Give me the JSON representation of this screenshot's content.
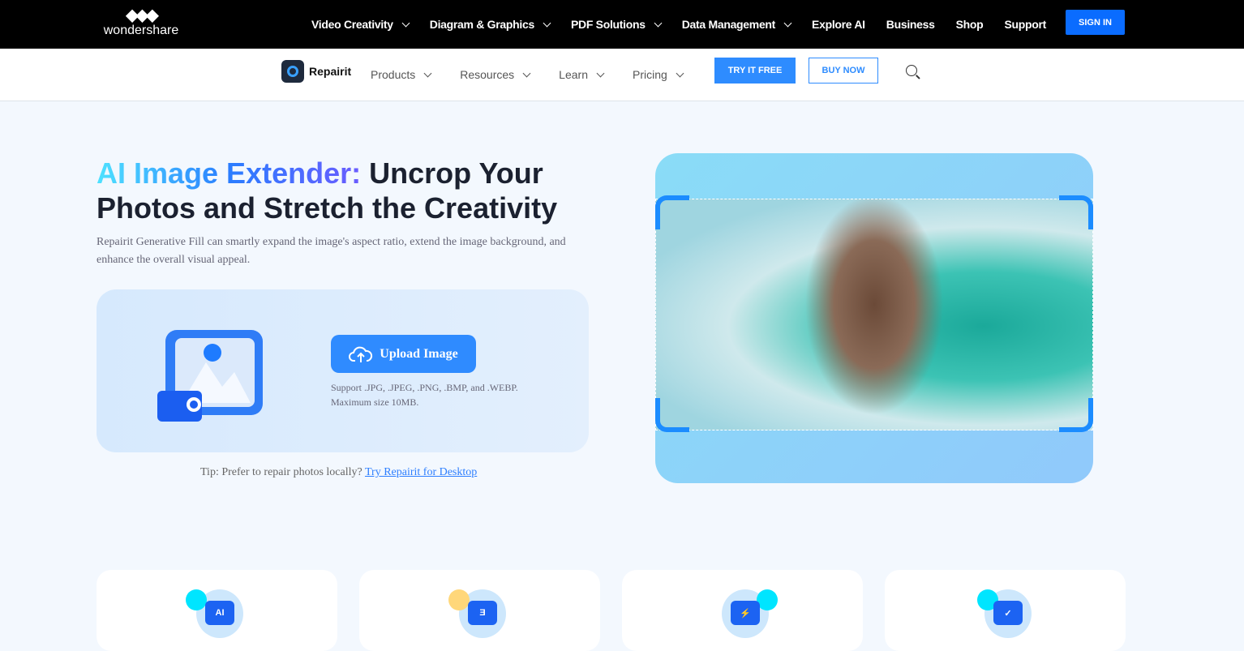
{
  "topbar": {
    "brand": "wondershare",
    "nav": [
      "Video Creativity",
      "Diagram & Graphics",
      "PDF Solutions",
      "Data Management",
      "Explore AI",
      "Business",
      "Shop",
      "Support"
    ],
    "nav_has_dropdown": [
      true,
      true,
      true,
      true,
      false,
      false,
      false,
      false
    ],
    "sign_in": "SIGN IN"
  },
  "subbar": {
    "brand": "Repairit",
    "nav": [
      "Products",
      "Resources",
      "Learn",
      "Pricing"
    ],
    "try_free": "TRY IT FREE",
    "buy_now": "BUY NOW"
  },
  "hero": {
    "title_highlight": "AI Image Extender:",
    "title_rest": " Uncrop Your Photos and Stretch the Creativity",
    "description": "Repairit Generative Fill can smartly expand the image's aspect ratio, extend the image background, and enhance the overall visual appeal.",
    "upload_label": "Upload Image",
    "support_line1": "Support .JPG, .JPEG, .PNG, .BMP, and .WEBP.",
    "support_line2": "Maximum size 10MB.",
    "tip_text": "Tip: Prefer to repair photos locally? ",
    "tip_link": "Try Repairit for Desktop"
  },
  "feature_cards": [
    {
      "icon": "ai-icon",
      "glyph": "AI",
      "dot": "#00e5ff"
    },
    {
      "icon": "expand-icon",
      "glyph": "Ǝ",
      "dot": "#ffd77a"
    },
    {
      "icon": "fast-icon",
      "glyph": "⚡",
      "dot": "#00e5ff"
    },
    {
      "icon": "shield-icon",
      "glyph": "✓",
      "dot": "#00e5ff"
    }
  ],
  "colors": {
    "accent": "#2e8cff",
    "sign_in": "#0a6cff",
    "topbar": "#000000",
    "page_bg": "#f3f8fe"
  }
}
